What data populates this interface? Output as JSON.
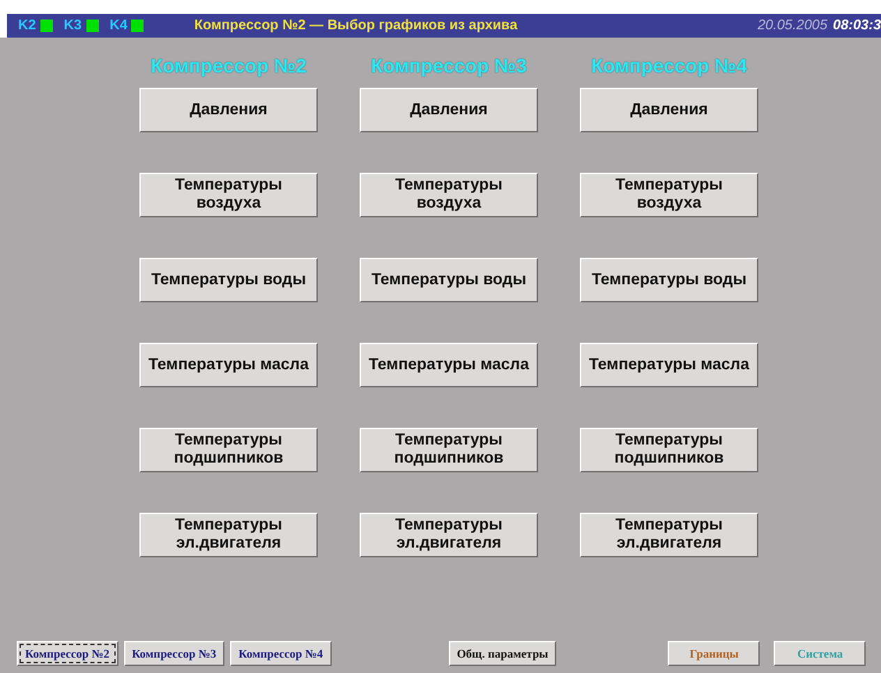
{
  "title_bar": {
    "indicators": [
      {
        "label": "K2",
        "on": true
      },
      {
        "label": "K3",
        "on": true
      },
      {
        "label": "K4",
        "on": true
      }
    ],
    "title": "Компрессор №2  — Выбор графиков из архива",
    "date": "20.05.2005",
    "time": "08:03:3"
  },
  "columns": [
    {
      "header": "Компрессор №2",
      "buttons": [
        "Давления",
        "Температуры воздуха",
        "Температуры воды",
        "Температуры масла",
        "Температуры подшипников",
        "Температуры эл.двигателя"
      ]
    },
    {
      "header": "Компрессор №3",
      "buttons": [
        "Давления",
        "Температуры воздуха",
        "Температуры воды",
        "Температуры масла",
        "Температуры подшипников",
        "Температуры эл.двигателя"
      ]
    },
    {
      "header": "Компрессор №4",
      "buttons": [
        "Давления",
        "Температуры воздуха",
        "Температуры воды",
        "Температуры масла",
        "Температуры подшипников",
        "Температуры эл.двигателя"
      ]
    }
  ],
  "bottom_bar": [
    {
      "label": "Компрессор №2",
      "kind": "compressor",
      "selected": true
    },
    {
      "label": "Компрессор №3",
      "kind": "compressor",
      "selected": false
    },
    {
      "label": "Компрессор №4",
      "kind": "compressor",
      "selected": false
    },
    {
      "label": "Общ. параметры",
      "kind": "common",
      "selected": false
    },
    {
      "label": "Границы",
      "kind": "limits",
      "selected": false
    },
    {
      "label": "Система",
      "kind": "system",
      "selected": false
    }
  ]
}
